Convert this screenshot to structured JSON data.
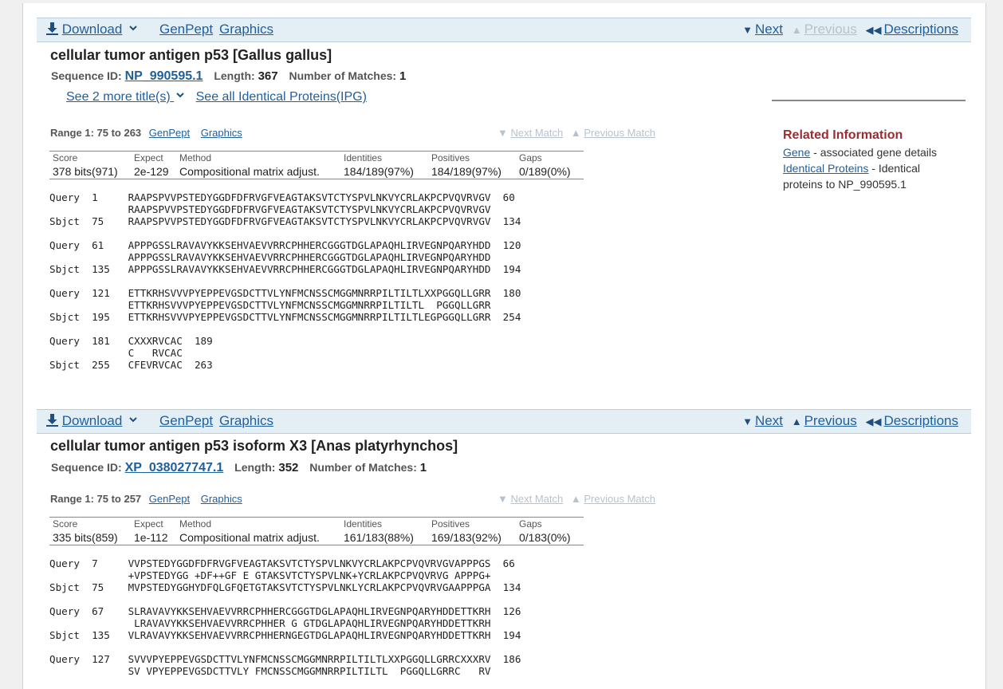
{
  "colors": {
    "link": "#1f5f9e",
    "toolbar_bg": "#e4eef5",
    "related_heading": "#9b2d30",
    "disabled": "#b8c2cc"
  },
  "hits": [
    {
      "toolbar": {
        "download": "Download",
        "genpept": "GenPept",
        "graphics": "Graphics",
        "next": "Next",
        "previous": "Previous",
        "descriptions": "Descriptions"
      },
      "title": "cellular tumor antigen p53 [Gallus gallus]",
      "seq_id_label": "Sequence ID:",
      "seq_id": "NP_990595.1",
      "length_label": "Length:",
      "length": "367",
      "matches_label": "Number of Matches:",
      "matches": "1",
      "more_titles": "See 2 more title(s)",
      "identical_proteins": "See all Identical Proteins(IPG)",
      "range": "Range 1: 75 to 263",
      "range_genpept": "GenPept",
      "range_graphics": "Graphics",
      "next_match": "Next Match",
      "previous_match": "Previous Match",
      "stats_headers": {
        "score": "Score",
        "expect": "Expect",
        "method": "Method",
        "identities": "Identities",
        "positives": "Positives",
        "gaps": "Gaps"
      },
      "stats": {
        "score": "378 bits(971)",
        "expect": "2e-129",
        "method": "Compositional matrix adjust.",
        "identities": "184/189(97%)",
        "positives": "184/189(97%)",
        "gaps": "0/189(0%)"
      },
      "alignment": "Query  1     RAAPSPVVPSTEDYGGDFDFRVGFVEAGTAKSVTCTYSPVLNKVYCRLAKPCPVQVRVGV  60\n             RAAPSPVVPSTEDYGGDFDFRVGFVEAGTAKSVTCTYSPVLNKVYCRLAKPCPVQVRVGV\nSbjct  75    RAAPSPVVPSTEDYGGDFDFRVGFVEAGTAKSVTCTYSPVLNKVYCRLAKPCPVQVRVGV  134\n\nQuery  61    APPPGSSLRAVAVYKKSEHVAEVVRRCPHHERCGGGTDGLAPAQHLIRVEGNPQARYHDD  120\n             APPPGSSLRAVAVYKKSEHVAEVVRRCPHHERCGGGTDGLAPAQHLIRVEGNPQARYHDD\nSbjct  135   APPPGSSLRAVAVYKKSEHVAEVVRRCPHHERCGGGTDGLAPAQHLIRVEGNPQARYHDD  194\n\nQuery  121   ETTKRHSVVVPYEPPEVGSDCTTVLYNFMCNSSCMGGMNRRPILTILTLXXPGGQLLGRR  180\n             ETTKRHSVVVPYEPPEVGSDCTTVLYNFMCNSSCMGGMNRRPILTILTL  PGGQLLGRR\nSbjct  195   ETTKRHSVVVPYEPPEVGSDCTTVLYNFMCNSSCMGGMNRRPILTILTLEGPGGQLLGRR  254\n\nQuery  181   CXXXRVCAC  189\n             C   RVCAC\nSbjct  255   CFEVRVCAC  263"
    },
    {
      "toolbar": {
        "download": "Download",
        "genpept": "GenPept",
        "graphics": "Graphics",
        "next": "Next",
        "previous": "Previous",
        "descriptions": "Descriptions"
      },
      "title": "cellular tumor antigen p53 isoform X3 [Anas platyrhynchos]",
      "seq_id_label": "Sequence ID:",
      "seq_id": "XP_038027747.1",
      "length_label": "Length:",
      "length": "352",
      "matches_label": "Number of Matches:",
      "matches": "1",
      "range": "Range 1: 75 to 257",
      "range_genpept": "GenPept",
      "range_graphics": "Graphics",
      "next_match": "Next Match",
      "previous_match": "Previous Match",
      "stats_headers": {
        "score": "Score",
        "expect": "Expect",
        "method": "Method",
        "identities": "Identities",
        "positives": "Positives",
        "gaps": "Gaps"
      },
      "stats": {
        "score": "335 bits(859)",
        "expect": "1e-112",
        "method": "Compositional matrix adjust.",
        "identities": "161/183(88%)",
        "positives": "169/183(92%)",
        "gaps": "0/183(0%)"
      },
      "alignment": "Query  7     VVPSTEDYGGDFDFRVGFVEAGTAKSVTCTYSPVLNKVYCRLAKPCPVQVRVGVAPPPGS  66\n             +VPSTEDYGG +DF++GF E GTAKSVTCTYSPVLNK+YCRLAKPCPVQVRVG APPPG+\nSbjct  75    MVPSTEDYGGHYDFQLGFQETGTAKSVTCTYSPVLNKLYCRLAKPCPVQVRVGAAPPPGA  134\n\nQuery  67    SLRAVAVYKKSEHVAEVVRRCPHHERCGGGTDGLAPAQHLIRVEGNPQARYHDDETTKRH  126\n              LRAVAVYKKSEHVAEVVRRCPHHER G GTDGLAPAQHLIRVEGNPQARYHDDETTKRH\nSbjct  135   VLRAVAVYKKSEHVAEVVRRCPHHERNGEGTDGLAPAQHLIRVEGNPQARYHDDETTKRH  194\n\nQuery  127   SVVVPYEPPEVGSDCTTVLYNFMCNSSCMGGMNRRPILTILTLXXPGGQLLGRRCXXXRV  186\n             SV VPYEPPEVGSDCTTVLY FMCNSSCMGGMNRRPILTILTL  PGGQLLGRRC   RV"
    }
  ],
  "related": {
    "heading": "Related Information",
    "gene_link": "Gene",
    "gene_desc": " - associated gene details",
    "ip_link": "Identical Proteins",
    "ip_desc": " - Identical proteins to NP_990595.1"
  }
}
